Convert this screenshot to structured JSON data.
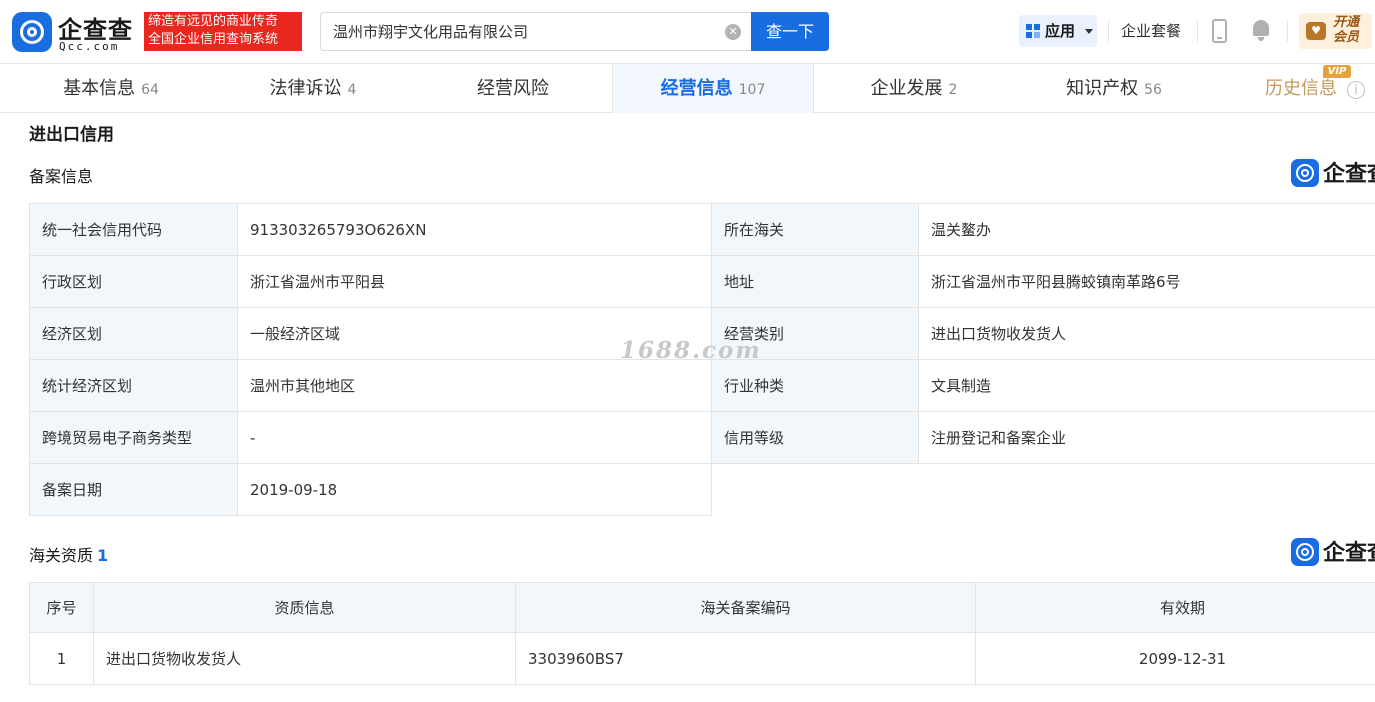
{
  "header": {
    "logo_cn": "企查查",
    "logo_en": "Qcc.com",
    "slogan_line1": "缔造有远见的商业传奇",
    "slogan_line2": "全国企业信用查询系统",
    "search_value": "温州市翔宇文化用品有限公司",
    "search_button": "查一下",
    "app_label": "应用",
    "package_label": "企业套餐",
    "vip_line1": "开通",
    "vip_line2": "会员"
  },
  "tabs": [
    {
      "label": "基本信息",
      "count": "64"
    },
    {
      "label": "法律诉讼",
      "count": "4"
    },
    {
      "label": "经营风险",
      "count": ""
    },
    {
      "label": "经营信息",
      "count": "107"
    },
    {
      "label": "企业发展",
      "count": "2"
    },
    {
      "label": "知识产权",
      "count": "56"
    },
    {
      "label": "历史信息",
      "count": ""
    }
  ],
  "vip_tag": "VIP",
  "section_title": "进出口信用",
  "filing": {
    "title": "备案信息",
    "watermark_logo": "企查查",
    "rows": [
      {
        "l1": "统一社会信用代码",
        "v1": "913303265793O626XN",
        "l2": "所在海关",
        "v2": "温关鳌办"
      },
      {
        "l1": "行政区划",
        "v1": "浙江省温州市平阳县",
        "l2": "地址",
        "v2": "浙江省温州市平阳县腾蛟镇南革路6号"
      },
      {
        "l1": "经济区划",
        "v1": "一般经济区域",
        "l2": "经营类别",
        "v2": "进出口货物收发货人"
      },
      {
        "l1": "统计经济区划",
        "v1": "温州市其他地区",
        "l2": "行业种类",
        "v2": "文具制造"
      },
      {
        "l1": "跨境贸易电子商务类型",
        "v1": "-",
        "l2": "信用等级",
        "v2": "注册登记和备案企业"
      },
      {
        "l1": "备案日期",
        "v1": "2019-09-18"
      }
    ]
  },
  "qualification": {
    "title": "海关资质",
    "count": "1",
    "watermark_logo": "企查查",
    "headers": [
      "序号",
      "资质信息",
      "海关备案编码",
      "有效期"
    ],
    "rows": [
      {
        "no": "1",
        "info": "进出口货物收发货人",
        "code": "3303960BS7",
        "valid": "2099-12-31"
      }
    ]
  },
  "watermark_text": "1688.com"
}
